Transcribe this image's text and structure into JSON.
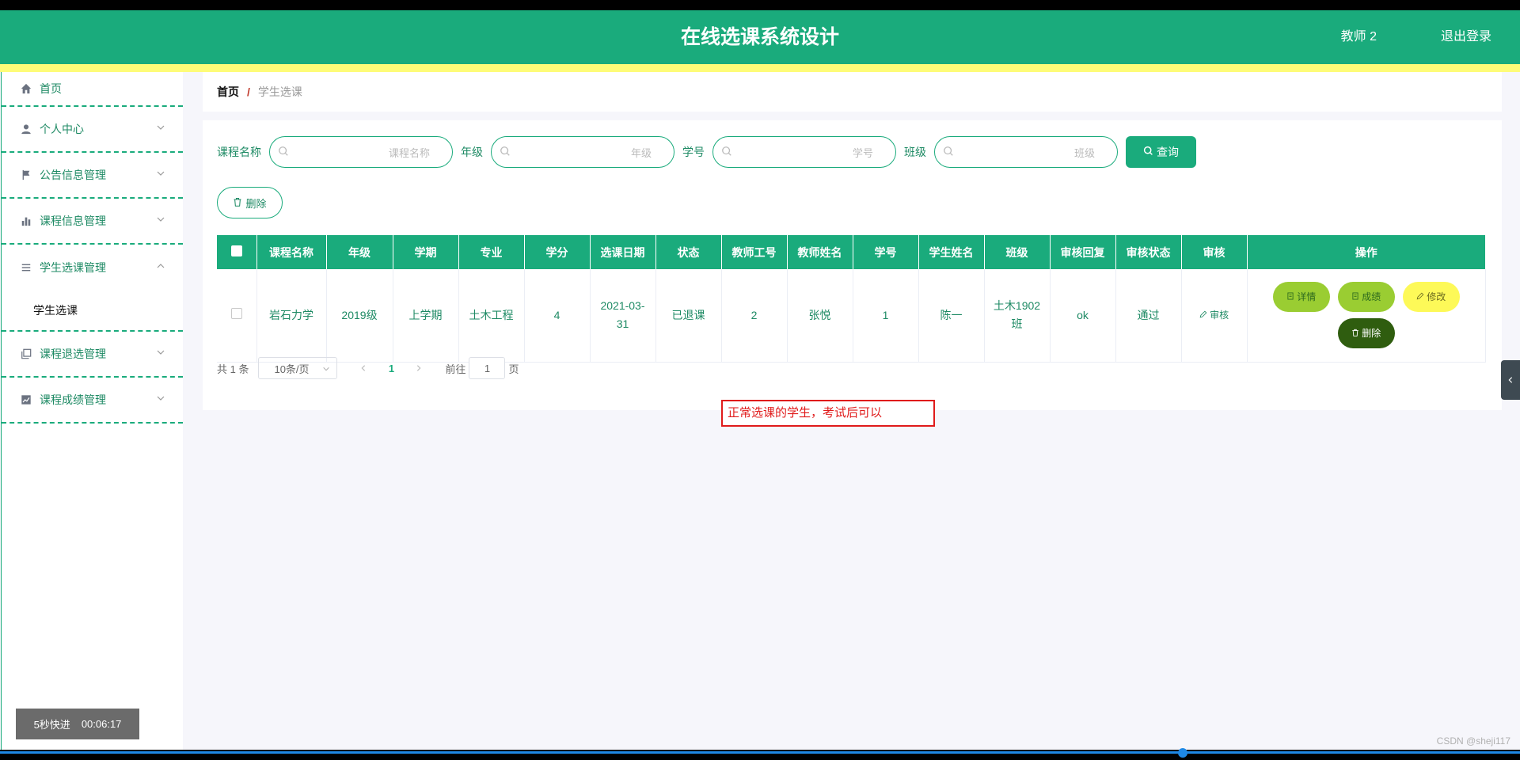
{
  "header": {
    "title": "在线选课系统设计",
    "user": "教师 2",
    "logout": "退出登录"
  },
  "sidebar": {
    "items": [
      {
        "label": "首页",
        "icon": "home-icon"
      },
      {
        "label": "个人中心",
        "icon": "user-icon"
      },
      {
        "label": "公告信息管理",
        "icon": "flag-icon"
      },
      {
        "label": "课程信息管理",
        "icon": "bar-chart-icon"
      },
      {
        "label": "学生选课管理",
        "icon": "list-icon",
        "sub": [
          "学生选课"
        ]
      },
      {
        "label": "课程退选管理",
        "icon": "copy-icon"
      },
      {
        "label": "课程成绩管理",
        "icon": "line-chart-icon"
      }
    ]
  },
  "breadcrumb": {
    "home": "首页",
    "sep": "/",
    "current": "学生选课"
  },
  "search": {
    "course_label": "课程名称",
    "course_placeholder": "课程名称",
    "grade_label": "年级",
    "grade_placeholder": "年级",
    "sno_label": "学号",
    "sno_placeholder": "学号",
    "class_label": "班级",
    "class_placeholder": "班级",
    "query": "查询"
  },
  "toolbar": {
    "delete": "删除"
  },
  "table": {
    "headers": [
      "课程名称",
      "年级",
      "学期",
      "专业",
      "学分",
      "选课日期",
      "状态",
      "教师工号",
      "教师姓名",
      "学号",
      "学生姓名",
      "班级",
      "审核回复",
      "审核状态",
      "审核",
      "操作"
    ],
    "rows": [
      {
        "course": "岩石力学",
        "grade": "2019级",
        "term": "上学期",
        "major": "土木工程",
        "credit": "4",
        "date1": "2021-03-",
        "date2": "31",
        "status": "已退课",
        "tno": "2",
        "tname": "张悦",
        "sno": "1",
        "sname": "陈一",
        "class1": "土木1902",
        "class2": "班",
        "reply": "ok",
        "audit_status": "通过",
        "audit": "审核"
      }
    ],
    "ops": {
      "detail": "详情",
      "score": "成绩",
      "edit": "修改",
      "delete": "删除"
    }
  },
  "pager": {
    "total": "共 1 条",
    "size": "10条/页",
    "page": "1",
    "goto": "前往",
    "goto_value": "1",
    "page_unit": "页"
  },
  "annotation": "正常选课的学生，考试后可以",
  "video": {
    "speed": "5秒快进",
    "time": "00:06:17"
  },
  "watermark": "CSDN @sheji117",
  "colors": {
    "primary": "#1aab7c",
    "yellow": "#fefc78",
    "danger": "#e01b1b"
  }
}
